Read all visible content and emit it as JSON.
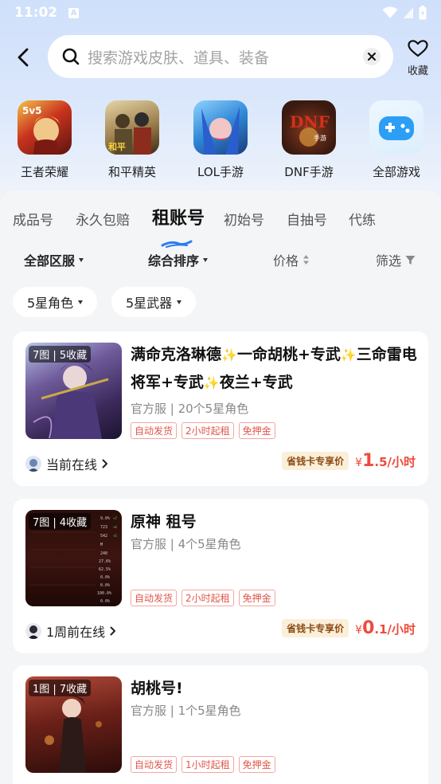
{
  "status_bar": {
    "time": "11:02",
    "notification_icon": "A"
  },
  "search": {
    "placeholder": "搜索游戏皮肤、道具、装备"
  },
  "favorites": {
    "label": "收藏"
  },
  "games": [
    {
      "label": "王者荣耀",
      "icon": "honor-of-kings-icon",
      "color": "#c9341e"
    },
    {
      "label": "和平精英",
      "icon": "peacekeeper-elite-icon",
      "color": "#8a6b3a"
    },
    {
      "label": "LOL手游",
      "icon": "lol-mobile-icon",
      "color": "#2f86d6"
    },
    {
      "label": "DNF手游",
      "icon": "dnf-mobile-icon",
      "color": "#4a2a1c"
    },
    {
      "label": "全部游戏",
      "icon": "gamepad-icon",
      "color": "#2b9ef5"
    }
  ],
  "tabs": [
    "成品号",
    "永久包赔",
    "租账号",
    "初始号",
    "自抽号",
    "代练"
  ],
  "active_tab": "租账号",
  "filters": {
    "region": "全部区服",
    "sort": "综合排序",
    "price": "价格",
    "filter": "筛选"
  },
  "chips": [
    "5星角色",
    "5星武器"
  ],
  "listings": [
    {
      "badge": "7图 | 5收藏",
      "title_parts": [
        "满命克洛琳德",
        "一命胡桃+专武",
        "三命雷电将军+专武",
        "夜兰+专武"
      ],
      "sub": "官方服 | 20个5星角色",
      "tags": [
        "自动发货",
        "2小时起租",
        "免押金"
      ],
      "online": "当前在线",
      "discount": "省钱卡专享价",
      "price_currency": "¥",
      "price_int": "1",
      "price_dec": ".5",
      "price_unit": "/小时"
    },
    {
      "badge": "7图 | 4收藏",
      "title": "原神 租号",
      "sub": "官方服 | 4个5星角色",
      "tags": [
        "自动发货",
        "2小时起租",
        "免押金"
      ],
      "online": "1周前在线",
      "discount": "省钱卡专享价",
      "price_currency": "¥",
      "price_int": "0",
      "price_dec": ".1",
      "price_unit": "/小时"
    },
    {
      "badge": "1图 | 7收藏",
      "title": "胡桃号!",
      "sub": "官方服 | 1个5星角色",
      "tags": [
        "自动发货",
        "1小时起租",
        "免押金"
      ]
    }
  ],
  "colors": {
    "accent": "#ef4a3c",
    "tab_underline": "#2a7cf0",
    "tag_border": "#f3a6a0"
  }
}
